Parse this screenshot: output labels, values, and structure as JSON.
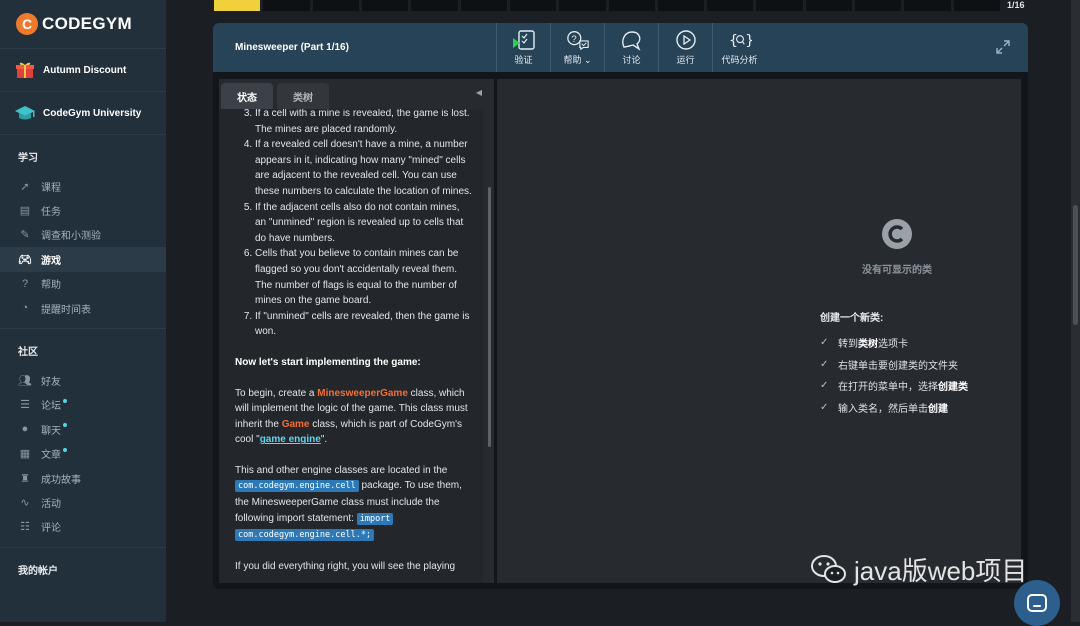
{
  "sidebar": {
    "logo_letter": "C",
    "logo_text": "CODEGYM",
    "promos": [
      {
        "label": "Autumn Discount",
        "icon": "gift-icon"
      },
      {
        "label": "CodeGym University",
        "icon": "graduation-cap-icon"
      }
    ],
    "learn_title": "学习",
    "learn_items": [
      {
        "label": "课程",
        "icon": "rocket-icon"
      },
      {
        "label": "任务",
        "icon": "tasks-icon"
      },
      {
        "label": "调查和小测验",
        "icon": "quiz-icon"
      },
      {
        "label": "游戏",
        "icon": "gamepad-icon",
        "active": true
      },
      {
        "label": "帮助",
        "icon": "help-icon"
      },
      {
        "label": "提醒时间表",
        "icon": "reminder-icon"
      }
    ],
    "community_title": "社区",
    "community_items": [
      {
        "label": "好友",
        "icon": "friends-icon"
      },
      {
        "label": "论坛",
        "icon": "forum-icon"
      },
      {
        "label": "聊天",
        "icon": "chat-icon"
      },
      {
        "label": "文章",
        "icon": "articles-icon"
      },
      {
        "label": "成功故事",
        "icon": "success-icon"
      },
      {
        "label": "活动",
        "icon": "activity-icon"
      },
      {
        "label": "评论",
        "icon": "comments-icon"
      }
    ],
    "account_title": "我的帐户"
  },
  "progress": {
    "completed": 1,
    "total": 16,
    "label": "1/16"
  },
  "toolbar": {
    "title": "Minesweeper (Part 1/16)",
    "tools": [
      {
        "label": "验证",
        "icon": "verify-icon"
      },
      {
        "label": "帮助",
        "icon": "help-chat-icon",
        "has_dropdown": true
      },
      {
        "label": "讨论",
        "icon": "discussion-icon"
      },
      {
        "label": "运行",
        "icon": "run-icon"
      },
      {
        "label": "代码分析",
        "icon": "code-analysis-icon"
      }
    ]
  },
  "tabs": {
    "status": "状态",
    "classes": "类树"
  },
  "content": {
    "list": [
      {
        "n": 3,
        "text": "If a cell with a mine is revealed, the game is lost. The mines are placed randomly."
      },
      {
        "n": 4,
        "text": "If a revealed cell doesn't have a mine, a number appears in it, indicating how many \"mined\" cells are adjacent to the revealed cell. You can use these numbers to calculate the location of mines."
      },
      {
        "n": 5,
        "text": "If the adjacent cells also do not contain mines, an \"unmined\" region is revealed up to cells that do have numbers."
      },
      {
        "n": 6,
        "text": "Cells that you believe to contain mines can be flagged so you don't accidentally reveal them. The number of flags is equal to the number of mines on the game board."
      },
      {
        "n": 7,
        "text": "If \"unmined\" cells are revealed, then the game is won."
      }
    ],
    "heading": "Now let's start implementing the game:",
    "p1_a": "To begin, create a ",
    "p1_class": "MinesweeperGame",
    "p1_b": " class, which will implement the logic of the game. This class must inherit the ",
    "p1_game": "Game",
    "p1_c": " class, which is part of CodeGym's cool \"",
    "p1_link": "game engine",
    "p1_d": "\".",
    "p2_a": "This and other engine classes are located in the ",
    "p2_pkg": "com.codegym.engine.cell",
    "p2_b": " package. To use them, the MinesweeperGame class must include the following import statement: ",
    "p2_import1": "import",
    "p2_import2": "com.codegym.engine.cell.*;",
    "p3": "If you did everything right, you will see the playing"
  },
  "right": {
    "empty_text": "没有可显示的类",
    "create_title": "创建一个新类:",
    "steps": [
      {
        "pre": "转到",
        "bold": "类树",
        "post": "选项卡"
      },
      {
        "pre": "右键单击要创建类的文件夹",
        "bold": "",
        "post": ""
      },
      {
        "pre": "在打开的菜单中，选择",
        "bold": "创建类",
        "post": ""
      },
      {
        "pre": "输入类名，然后单击",
        "bold": "创建",
        "post": ""
      }
    ]
  },
  "watermark": {
    "text": "java版web项目",
    "icon": "wechat-icon"
  },
  "colors": {
    "accent": "#f1d13b",
    "toolbar": "#274357",
    "orange": "#f36e34",
    "link": "#60d3ef",
    "code_bg": "#2d79b8"
  }
}
